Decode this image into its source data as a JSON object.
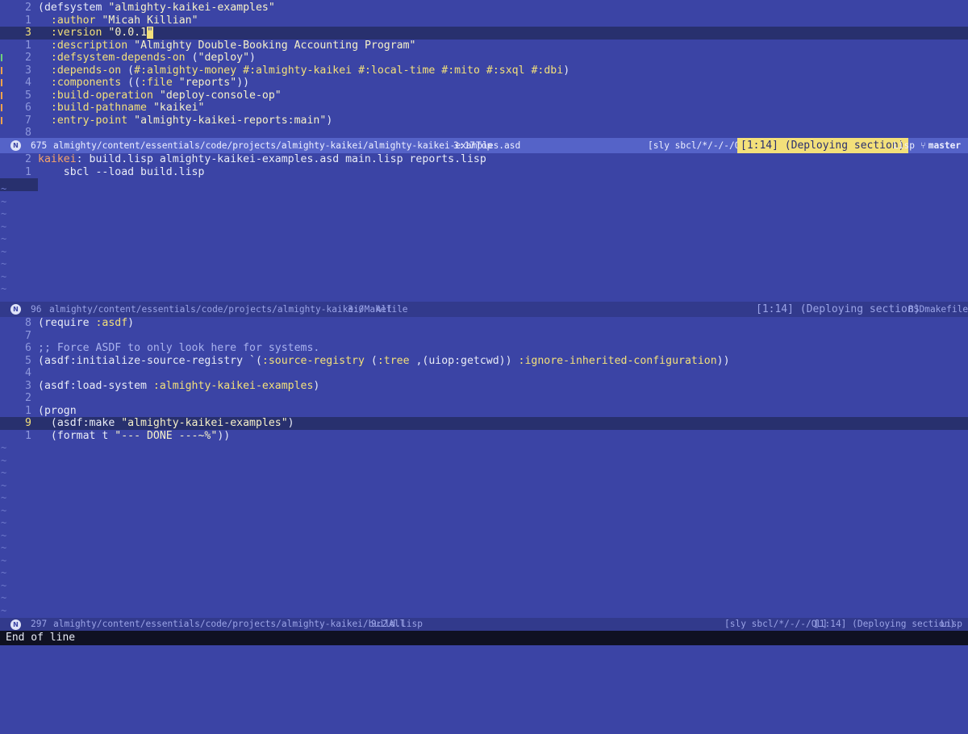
{
  "pane1": {
    "lines": [
      {
        "gut": "2",
        "code": [
          {
            "t": "(defsystem "
          },
          {
            "t": "\"almighty-kaikei-examples\"",
            "c": "s"
          }
        ]
      },
      {
        "gut": "1",
        "code": [
          {
            "t": "  "
          },
          {
            "t": ":author",
            "c": "k"
          },
          {
            "t": " "
          },
          {
            "t": "\"Micah Killian\"",
            "c": "s"
          }
        ]
      },
      {
        "gut": "3",
        "cur": true,
        "code": [
          {
            "t": "  "
          },
          {
            "t": ":version",
            "c": "k"
          },
          {
            "t": " "
          },
          {
            "t": "\"0.0.1",
            "c": "s"
          },
          {
            "t": "\"",
            "c": "cursor"
          }
        ]
      },
      {
        "gut": "1",
        "code": [
          {
            "t": "  "
          },
          {
            "t": ":description",
            "c": "k"
          },
          {
            "t": " "
          },
          {
            "t": "\"Almighty Double-Booking Accounting Program\"",
            "c": "s"
          }
        ]
      },
      {
        "gut": "2",
        "mark": "g",
        "code": [
          {
            "t": "  "
          },
          {
            "t": ":defsystem-depends-on",
            "c": "k"
          },
          {
            "t": " ("
          },
          {
            "t": "\"deploy\"",
            "c": "s"
          },
          {
            "t": ")"
          }
        ]
      },
      {
        "gut": "3",
        "mark": "o",
        "code": [
          {
            "t": "  "
          },
          {
            "t": ":depends-on",
            "c": "k"
          },
          {
            "t": " ("
          },
          {
            "t": "#:almighty-money",
            "c": "k"
          },
          {
            "t": " "
          },
          {
            "t": "#:almighty-kaikei",
            "c": "k"
          },
          {
            "t": " "
          },
          {
            "t": "#:local-time",
            "c": "k"
          },
          {
            "t": " "
          },
          {
            "t": "#:mito",
            "c": "k"
          },
          {
            "t": " "
          },
          {
            "t": "#:sxql",
            "c": "k"
          },
          {
            "t": " "
          },
          {
            "t": "#:dbi",
            "c": "k"
          },
          {
            "t": ")"
          }
        ]
      },
      {
        "gut": "4",
        "mark": "o",
        "code": [
          {
            "t": "  "
          },
          {
            "t": ":components",
            "c": "k"
          },
          {
            "t": " (("
          },
          {
            "t": ":file",
            "c": "k"
          },
          {
            "t": " "
          },
          {
            "t": "\"reports\"",
            "c": "s"
          },
          {
            "t": "))"
          }
        ]
      },
      {
        "gut": "5",
        "mark": "o",
        "code": [
          {
            "t": "  "
          },
          {
            "t": ":build-operation",
            "c": "k"
          },
          {
            "t": " "
          },
          {
            "t": "\"deploy-console-op\"",
            "c": "s"
          }
        ]
      },
      {
        "gut": "6",
        "mark": "o",
        "code": [
          {
            "t": "  "
          },
          {
            "t": ":build-pathname",
            "c": "k"
          },
          {
            "t": " "
          },
          {
            "t": "\"kaikei\"",
            "c": "s"
          }
        ]
      },
      {
        "gut": "7",
        "mark": "o",
        "code": [
          {
            "t": "  "
          },
          {
            "t": ":entry-point",
            "c": "k"
          },
          {
            "t": " "
          },
          {
            "t": "\"almighty-kaikei-reports:main\"",
            "c": "s"
          },
          {
            "t": ")"
          }
        ]
      },
      {
        "gut": "8",
        "code": []
      }
    ],
    "modeline": {
      "badge": "N",
      "size": "675",
      "path": "almighty/content/essentials/code/projects/almighty-kaikei/almighty-kaikei-examples.asd",
      "pos": "3:17",
      "scroll": "Top",
      "repl": "[sly sbcl/*/-/-/QL]",
      "section": "[1:14] (Deploying section)",
      "mode": "Lisp",
      "branch": "master"
    }
  },
  "pane2": {
    "lines": [
      {
        "gut": "2",
        "code": [
          {
            "t": "kaikei",
            "c": "t"
          },
          {
            "t": ": build.lisp almighty-kaikei-examples.asd main.lisp reports.lisp"
          }
        ]
      },
      {
        "gut": "1",
        "code": [
          {
            "t": "    sbcl --load build.lisp"
          }
        ]
      }
    ],
    "modeline": {
      "badge": "N",
      "size": "96",
      "path": "almighty/content/essentials/code/projects/almighty-kaikei/Makefile",
      "pos": "3:0",
      "scroll": "All",
      "section": "[1:14] (Deploying section)",
      "mode": "BSDmakefile"
    }
  },
  "pane3": {
    "lines": [
      {
        "gut": "8",
        "code": [
          {
            "t": "(require "
          },
          {
            "t": ":asdf",
            "c": "k"
          },
          {
            "t": ")"
          }
        ]
      },
      {
        "gut": "7",
        "code": []
      },
      {
        "gut": "6",
        "code": [
          {
            "t": ";; Force ASDF to only look here for systems.",
            "c": "c"
          }
        ]
      },
      {
        "gut": "5",
        "code": [
          {
            "t": "(asdf:initialize-source-registry `("
          },
          {
            "t": ":source-registry",
            "c": "k"
          },
          {
            "t": " ("
          },
          {
            "t": ":tree",
            "c": "k"
          },
          {
            "t": " ,(uiop:getcwd)) "
          },
          {
            "t": ":ignore-inherited-configuration",
            "c": "k"
          },
          {
            "t": "))"
          }
        ]
      },
      {
        "gut": "4",
        "code": []
      },
      {
        "gut": "3",
        "code": [
          {
            "t": "(asdf:load-system "
          },
          {
            "t": ":almighty-kaikei-examples",
            "c": "k"
          },
          {
            "t": ")"
          }
        ]
      },
      {
        "gut": "2",
        "code": []
      },
      {
        "gut": "1",
        "code": [
          {
            "t": "(progn"
          }
        ]
      },
      {
        "gut": "9",
        "cur": true,
        "code": [
          {
            "t": "  (asdf:make "
          },
          {
            "t": "\"almighty-kaikei-examples\"",
            "c": "s"
          },
          {
            "t": ")"
          }
        ]
      },
      {
        "gut": "1",
        "code": [
          {
            "t": "  (format t "
          },
          {
            "t": "\"--- DONE ---~%\"",
            "c": "s"
          },
          {
            "t": "))"
          }
        ]
      }
    ],
    "modeline": {
      "badge": "N",
      "size": "297",
      "path": "almighty/content/essentials/code/projects/almighty-kaikei/build.lisp",
      "pos": "9:2",
      "scroll": "All",
      "repl": "[sly sbcl/*/-/-/QL]",
      "section": "[1:14] (Deploying section)",
      "mode": "Lisp"
    }
  },
  "tilde": "~",
  "echo": "End of line"
}
